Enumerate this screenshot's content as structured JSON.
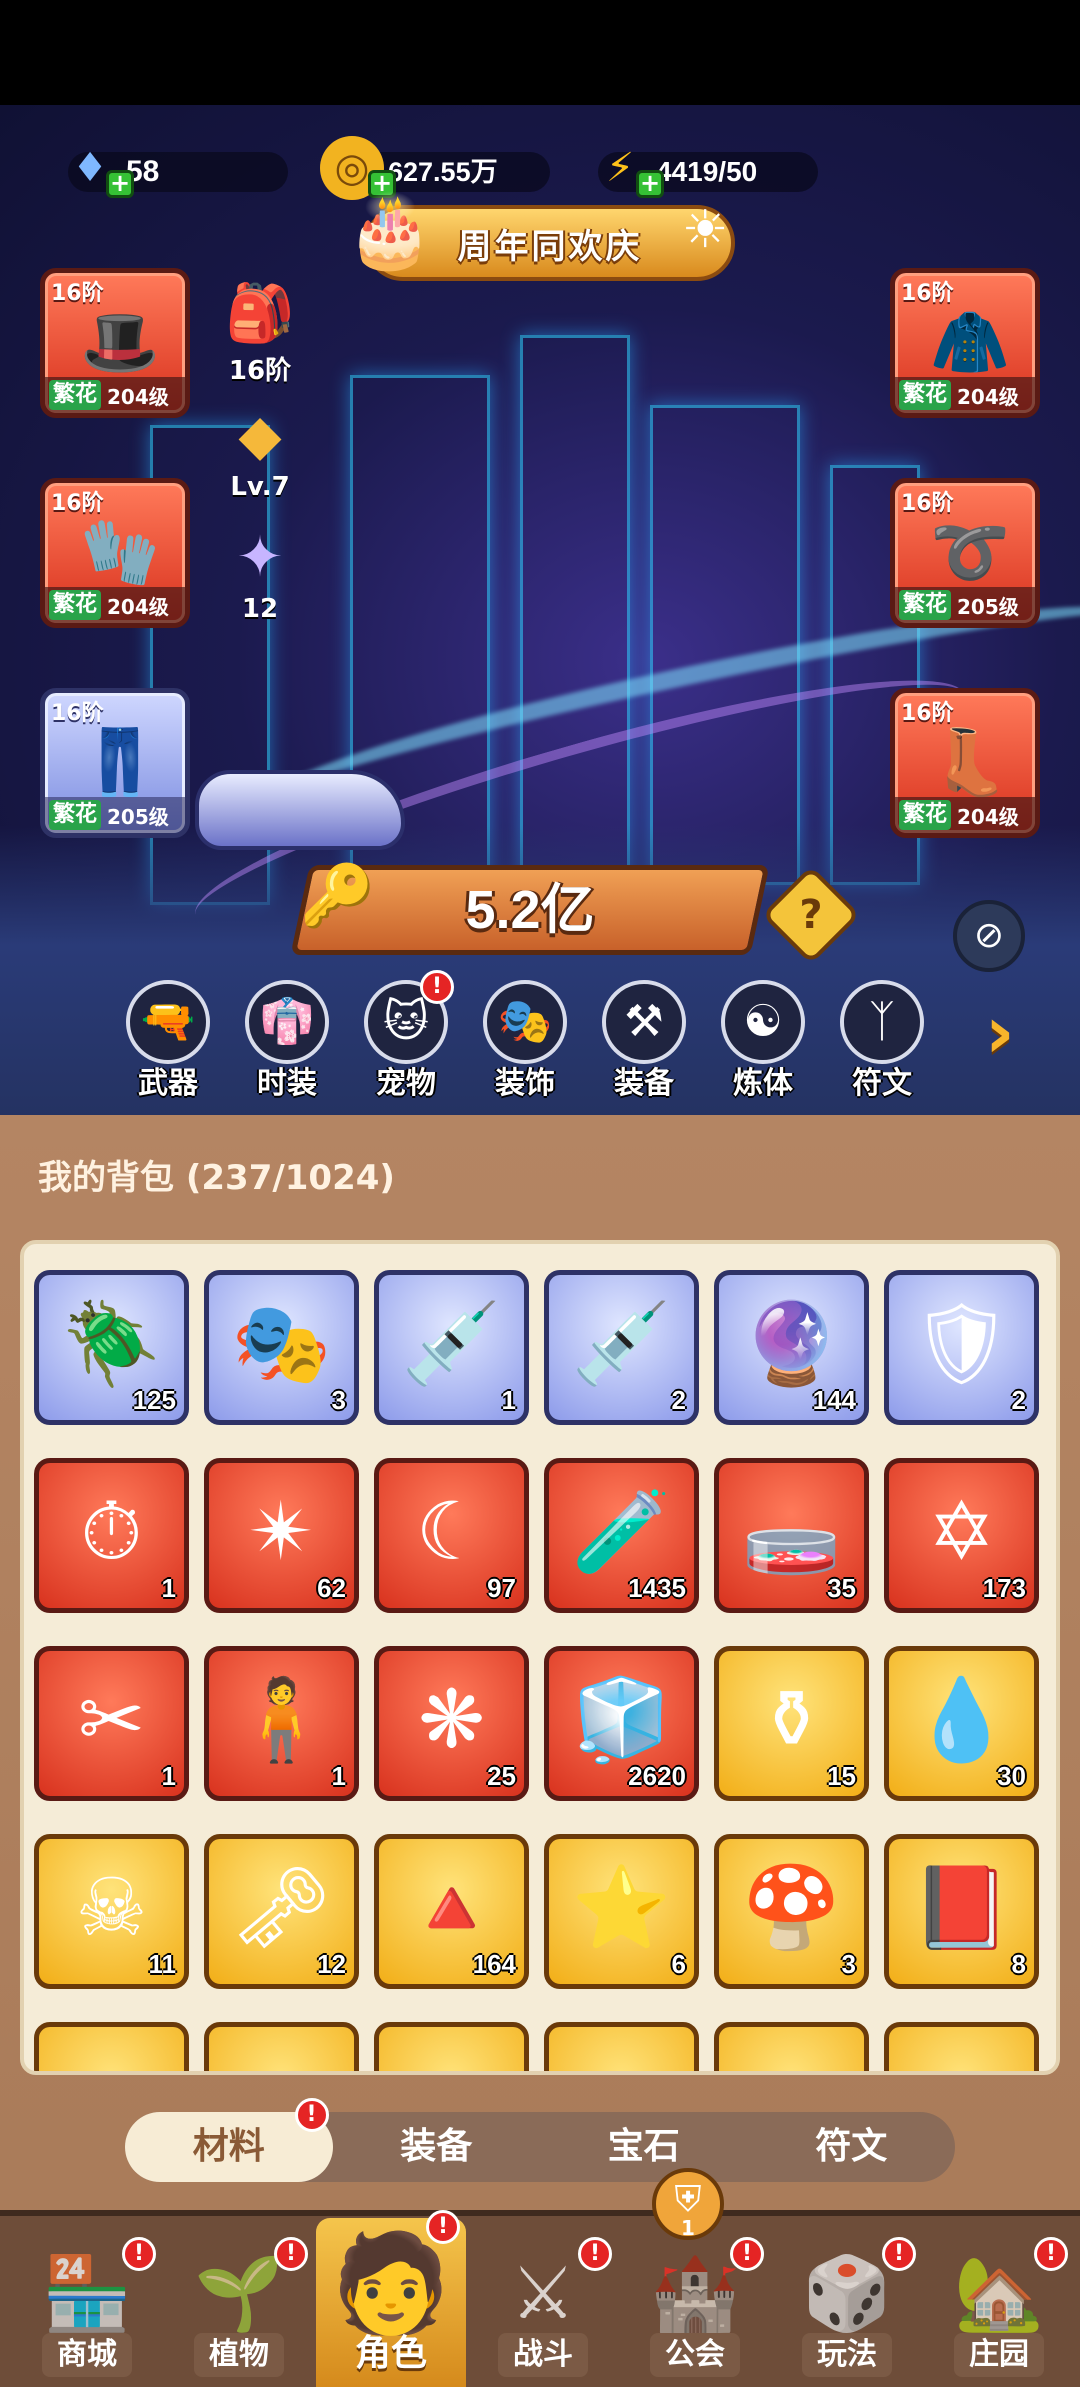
{
  "resources": {
    "diamonds": "58",
    "coins": "627.55万",
    "energy": "4419/50"
  },
  "banner": {
    "label": "周年同欢庆"
  },
  "equipment_left": [
    {
      "tier": "16阶",
      "name": "繁花",
      "level": "204级",
      "icon": "wizard-hat"
    },
    {
      "tier": "16阶",
      "name": "繁花",
      "level": "204级",
      "icon": "gloves"
    },
    {
      "tier": "16阶",
      "name": "繁花",
      "level": "205级",
      "icon": "pants"
    }
  ],
  "equipment_right": [
    {
      "tier": "16阶",
      "name": "繁花",
      "level": "204级",
      "icon": "coat"
    },
    {
      "tier": "16阶",
      "name": "繁花",
      "level": "205级",
      "icon": "belt"
    },
    {
      "tier": "16阶",
      "name": "繁花",
      "level": "204级",
      "icon": "boots"
    }
  ],
  "mid_icons": [
    {
      "text": "16阶",
      "icon": "bag"
    },
    {
      "text": "Lv.7",
      "icon": "crystal"
    },
    {
      "text": "12",
      "icon": "galaxy-orb"
    }
  ],
  "power": {
    "value": "5.2亿"
  },
  "tabs": [
    {
      "label": "武器",
      "icon": "weapon-icon",
      "alert": false
    },
    {
      "label": "时装",
      "icon": "costume-icon",
      "alert": false
    },
    {
      "label": "宠物",
      "icon": "pet-icon",
      "alert": true
    },
    {
      "label": "装饰",
      "icon": "mask-icon",
      "alert": false
    },
    {
      "label": "装备",
      "icon": "equipment-icon",
      "alert": false
    },
    {
      "label": "炼体",
      "icon": "body-icon",
      "alert": false
    },
    {
      "label": "符文",
      "icon": "rune-icon",
      "alert": false
    }
  ],
  "bag": {
    "title": "我的背包 (237/1024)",
    "items": [
      {
        "count": "125",
        "rarity": "blue",
        "icon": "scarab"
      },
      {
        "count": "3",
        "rarity": "blue",
        "icon": "mask"
      },
      {
        "count": "1",
        "rarity": "blue",
        "icon": "syringe"
      },
      {
        "count": "2",
        "rarity": "blue",
        "icon": "syringe-cloud"
      },
      {
        "count": "144",
        "rarity": "blue",
        "icon": "ring-orb"
      },
      {
        "count": "2",
        "rarity": "blue",
        "icon": "knight-portrait"
      },
      {
        "count": "1",
        "rarity": "red",
        "icon": "clock-card"
      },
      {
        "count": "62",
        "rarity": "red",
        "icon": "star-crystal"
      },
      {
        "count": "97",
        "rarity": "red",
        "icon": "moon-star"
      },
      {
        "count": "1435",
        "rarity": "red",
        "icon": "red-potion"
      },
      {
        "count": "35",
        "rarity": "red",
        "icon": "green-tube"
      },
      {
        "count": "173",
        "rarity": "red",
        "icon": "hexagram"
      },
      {
        "count": "1",
        "rarity": "red",
        "icon": "scissors"
      },
      {
        "count": "1",
        "rarity": "red",
        "icon": "chibi-figure"
      },
      {
        "count": "25",
        "rarity": "red",
        "icon": "knot"
      },
      {
        "count": "2620",
        "rarity": "red",
        "icon": "blue-cubes"
      },
      {
        "count": "15",
        "rarity": "gold",
        "icon": "gold-vase"
      },
      {
        "count": "30",
        "rarity": "gold",
        "icon": "water-drop"
      },
      {
        "count": "11",
        "rarity": "gold",
        "icon": "skull-scroll"
      },
      {
        "count": "12",
        "rarity": "gold",
        "icon": "gold-key"
      },
      {
        "count": "164",
        "rarity": "gold",
        "icon": "fire-prism"
      },
      {
        "count": "6",
        "rarity": "gold",
        "icon": "star-medal"
      },
      {
        "count": "3",
        "rarity": "gold",
        "icon": "mushroom"
      },
      {
        "count": "8",
        "rarity": "gold",
        "icon": "spell-book"
      },
      {
        "count": "",
        "rarity": "gold",
        "icon": "partial"
      },
      {
        "count": "",
        "rarity": "gold",
        "icon": "partial"
      },
      {
        "count": "",
        "rarity": "gold",
        "icon": "partial"
      },
      {
        "count": "",
        "rarity": "gold",
        "icon": "partial"
      },
      {
        "count": "",
        "rarity": "gold",
        "icon": "partial"
      },
      {
        "count": "",
        "rarity": "gold",
        "icon": "partial"
      }
    ]
  },
  "filters": [
    {
      "label": "材料",
      "active": true,
      "alert": true
    },
    {
      "label": "装备",
      "active": false,
      "alert": false
    },
    {
      "label": "宝石",
      "active": false,
      "alert": false
    },
    {
      "label": "符文",
      "active": false,
      "alert": false
    }
  ],
  "nav": [
    {
      "label": "商城",
      "alert": true,
      "active": false,
      "icon": "shop-icon"
    },
    {
      "label": "植物",
      "alert": true,
      "active": false,
      "icon": "plant-icon"
    },
    {
      "label": "角色",
      "alert": true,
      "active": true,
      "icon": "character-icon"
    },
    {
      "label": "战斗",
      "alert": true,
      "active": false,
      "icon": "battle-icon"
    },
    {
      "label": "公会",
      "alert": true,
      "active": false,
      "icon": "guild-icon"
    },
    {
      "label": "玩法",
      "alert": true,
      "active": false,
      "icon": "gameplay-icon"
    },
    {
      "label": "庄园",
      "alert": true,
      "active": false,
      "icon": "manor-icon"
    }
  ],
  "guild_badge": "1",
  "alert_mark": "!"
}
